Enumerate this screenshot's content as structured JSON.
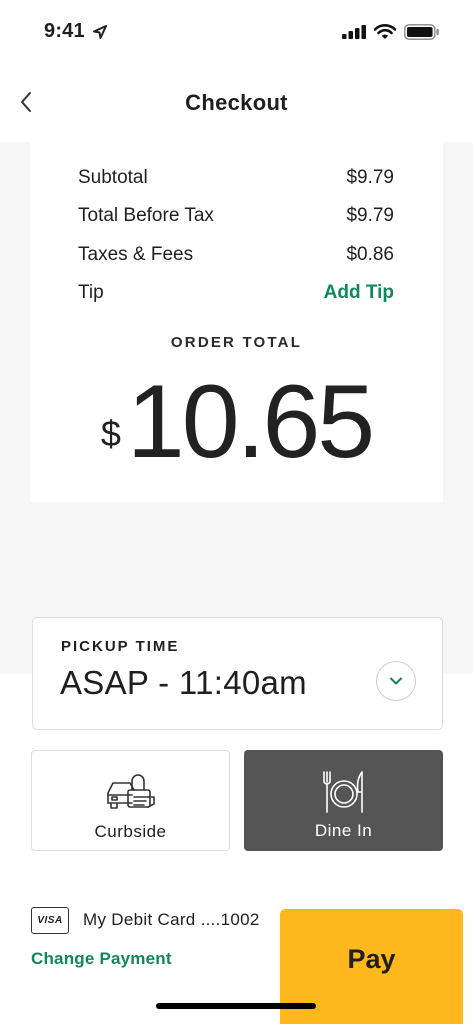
{
  "status_bar": {
    "time": "9:41"
  },
  "header": {
    "title": "Checkout"
  },
  "summary": {
    "rows": [
      {
        "label": "Subtotal",
        "amount": "$9.79"
      },
      {
        "label": "Total Before Tax",
        "amount": "$9.79"
      },
      {
        "label": "Taxes & Fees",
        "amount": "$0.86"
      }
    ],
    "tip": {
      "label": "Tip",
      "action": "Add Tip"
    },
    "order_total": {
      "label": "ORDER TOTAL",
      "currency": "$",
      "amount": "10.65"
    }
  },
  "pickup": {
    "label": "PICKUP TIME",
    "value": "ASAP - 11:40am"
  },
  "modes": {
    "curbside": {
      "label": "Curbside",
      "selected": false
    },
    "dine_in": {
      "label": "Dine In",
      "selected": true
    }
  },
  "payment": {
    "card_brand": "VISA",
    "card_name": "My Debit Card ....1002",
    "change_label": "Change Payment"
  },
  "pay_button": {
    "label": "Pay"
  },
  "colors": {
    "accent_green": "#12875d",
    "pay_yellow": "#ffb81c",
    "selected_dark": "#555555"
  },
  "icons": [
    "location-arrow-icon",
    "signal-icon",
    "wifi-icon",
    "battery-icon",
    "back-chevron-icon",
    "chevron-down-icon",
    "curbside-car-icon",
    "dine-in-plate-icon",
    "visa-card-icon"
  ]
}
